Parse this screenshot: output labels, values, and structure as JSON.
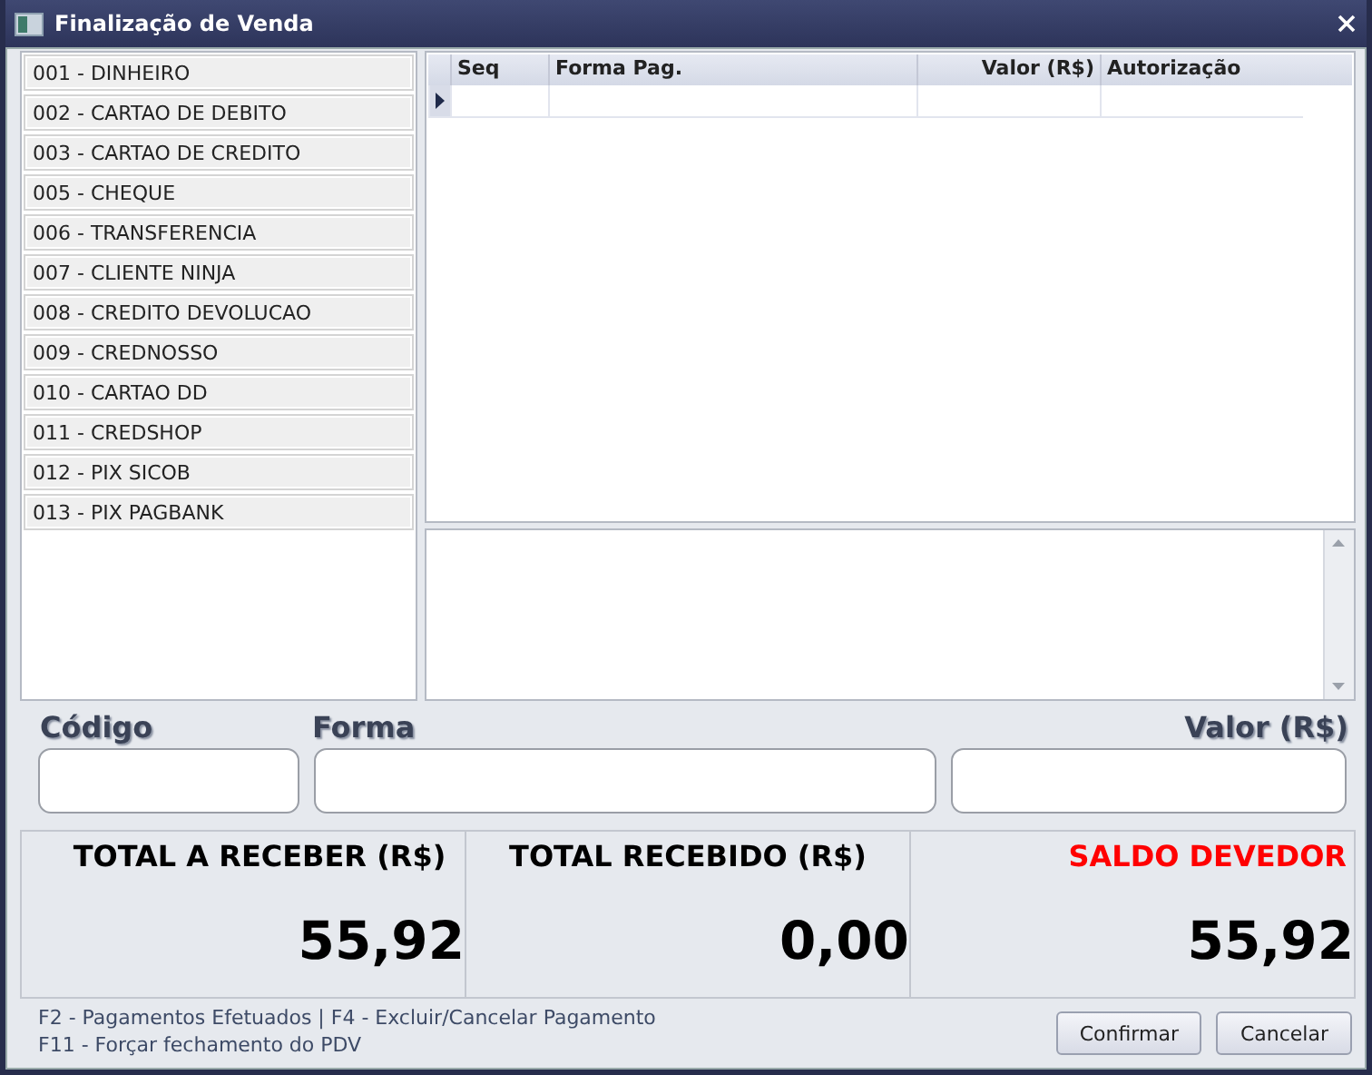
{
  "window": {
    "title": "Finalização de Venda"
  },
  "payment_methods": [
    {
      "label": "001 - DINHEIRO"
    },
    {
      "label": "002 - CARTAO DE DEBITO"
    },
    {
      "label": "003 - CARTAO DE CREDITO"
    },
    {
      "label": "005 - CHEQUE"
    },
    {
      "label": "006 - TRANSFERENCIA"
    },
    {
      "label": "007 - CLIENTE NINJA"
    },
    {
      "label": "008 - CREDITO DEVOLUCAO"
    },
    {
      "label": "009 - CREDNOSSO"
    },
    {
      "label": "010 - CARTAO DD"
    },
    {
      "label": "011 - CREDSHOP"
    },
    {
      "label": "012 - PIX SICOB"
    },
    {
      "label": "013 - PIX PAGBANK"
    }
  ],
  "table": {
    "columns": [
      "Seq",
      "Forma Pag.",
      "Valor (R$)",
      "Autorização"
    ]
  },
  "fields": [
    {
      "label": "Código"
    },
    {
      "label": "Forma"
    },
    {
      "label": "Valor (R$)"
    }
  ],
  "totals": [
    {
      "label": "TOTAL A RECEBER (R$)",
      "value": "55,92",
      "color": "#000000"
    },
    {
      "label": "TOTAL RECEBIDO (R$)",
      "value": "0,00",
      "color": "#000000"
    },
    {
      "label": "SALDO DEVEDOR",
      "value": "55,92",
      "color": "#ff0000"
    }
  ],
  "shortcuts": [
    "F2 - Pagamentos Efetuados | F4 - Excluir/Cancelar Pagamento",
    "F11 - Forçar fechamento do PDV"
  ],
  "buttons": [
    "Confirmar",
    "Cancelar"
  ]
}
